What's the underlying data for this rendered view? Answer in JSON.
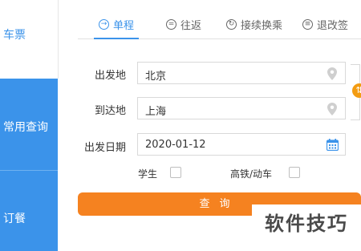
{
  "sidebar": {
    "top_label": "车票",
    "items": [
      {
        "label": "常用查询"
      },
      {
        "label": "订餐"
      }
    ]
  },
  "tabs": [
    {
      "label": "单程",
      "icon": "arrow-circle-icon",
      "active": true
    },
    {
      "label": "往返",
      "icon": "equal-circle-icon",
      "active": false
    },
    {
      "label": "接续换乘",
      "icon": "refresh-circle-icon",
      "active": false
    },
    {
      "label": "退改签",
      "icon": "list-circle-icon",
      "active": false
    }
  ],
  "form": {
    "from_label": "出发地",
    "from_value": "北京",
    "to_label": "到达地",
    "to_value": "上海",
    "date_label": "出发日期",
    "date_value": "2020-01-12",
    "student_label": "学生",
    "highspeed_label": "高铁/动车",
    "search_label": "查询"
  },
  "watermark": "软件技巧",
  "colors": {
    "accent_blue": "#3b93ea",
    "accent_orange": "#f58220"
  }
}
